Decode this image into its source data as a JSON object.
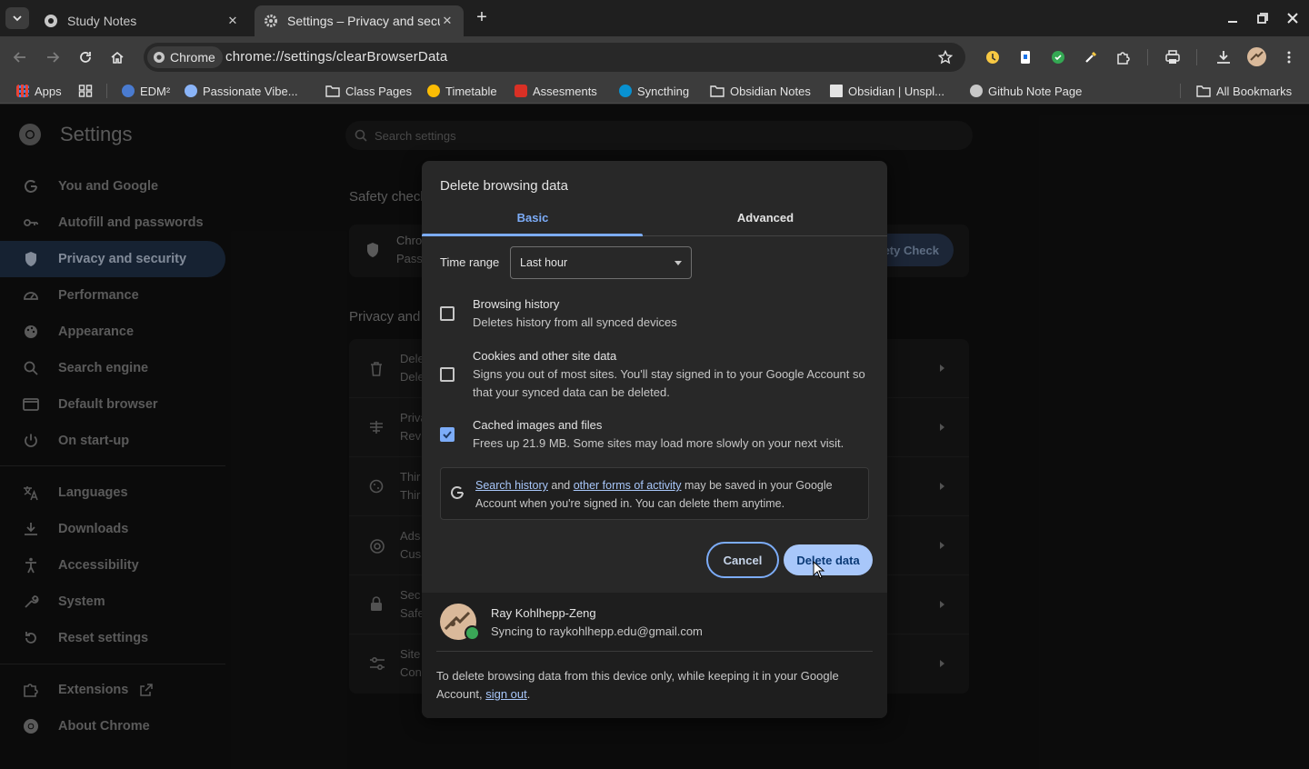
{
  "browser": {
    "tabs": [
      {
        "title": "Study Notes"
      },
      {
        "title": "Settings – Privacy and security"
      }
    ],
    "omnibox": {
      "chip": "Chrome",
      "url": "chrome://settings/clearBrowserData"
    },
    "bookmarks": [
      {
        "label": "Apps",
        "icon": "apps-grid-icon"
      },
      {
        "label": "EDM²",
        "icon": "edm-favicon"
      },
      {
        "label": "Passionate Vibe...",
        "icon": "globe-favicon"
      },
      {
        "label": "Class Pages",
        "icon": "folder-icon"
      },
      {
        "label": "Timetable",
        "icon": "timetable-favicon"
      },
      {
        "label": "Assesments",
        "icon": "assessments-favicon"
      },
      {
        "label": "Syncthing",
        "icon": "syncthing-favicon"
      },
      {
        "label": "Obsidian Notes",
        "icon": "folder-icon"
      },
      {
        "label": "Obsidian | Unspl...",
        "icon": "unsplash-favicon"
      },
      {
        "label": "Github Note Page",
        "icon": "globe-favicon"
      },
      {
        "label": "All Bookmarks",
        "icon": "folder-icon"
      }
    ]
  },
  "settings": {
    "title": "Settings",
    "search_placeholder": "Search settings",
    "nav": [
      {
        "label": "You and Google",
        "icon": "google-icon"
      },
      {
        "label": "Autofill and passwords",
        "icon": "key-icon"
      },
      {
        "label": "Privacy and security",
        "icon": "shield-icon"
      },
      {
        "label": "Performance",
        "icon": "speedometer-icon"
      },
      {
        "label": "Appearance",
        "icon": "palette-icon"
      },
      {
        "label": "Search engine",
        "icon": "search-icon"
      },
      {
        "label": "Default browser",
        "icon": "browser-window-icon"
      },
      {
        "label": "On start-up",
        "icon": "power-icon"
      },
      {
        "label": "Languages",
        "icon": "translate-icon"
      },
      {
        "label": "Downloads",
        "icon": "download-icon"
      },
      {
        "label": "Accessibility",
        "icon": "accessibility-icon"
      },
      {
        "label": "System",
        "icon": "wrench-icon"
      },
      {
        "label": "Reset settings",
        "icon": "reset-icon"
      },
      {
        "label": "Extensions",
        "icon": "puzzle-icon"
      },
      {
        "label": "About Chrome",
        "icon": "chrome-icon"
      }
    ],
    "safety_check_heading": "Safety check",
    "safety_card": {
      "line1": "Chro",
      "line2": "Pass",
      "button": "ety Check"
    },
    "privacy_heading": "Privacy and",
    "privacy_rows": [
      {
        "l1": "Dele",
        "l2": "Dele",
        "icon": "trash-icon"
      },
      {
        "l1": "Priva",
        "l2": "Revi",
        "icon": "privacy-guide-icon"
      },
      {
        "l1": "Thir",
        "l2": "Thir",
        "icon": "cookie-icon"
      },
      {
        "l1": "Ads",
        "l2": "Cus",
        "icon": "ads-icon"
      },
      {
        "l1": "Sec",
        "l2": "Safe",
        "icon": "lock-icon"
      },
      {
        "l1": "Site",
        "l2": "Con",
        "icon": "sliders-icon"
      }
    ]
  },
  "dialog": {
    "title": "Delete browsing data",
    "tabs": {
      "basic": "Basic",
      "advanced": "Advanced"
    },
    "time_range_label": "Time range",
    "time_range_value": "Last hour",
    "options": [
      {
        "title": "Browsing history",
        "desc": "Deletes history from all synced devices",
        "checked": false
      },
      {
        "title": "Cookies and other site data",
        "desc": "Signs you out of most sites. You'll stay signed in to your Google Account so that your synced data can be deleted.",
        "checked": false
      },
      {
        "title": "Cached images and files",
        "desc": "Frees up 21.9 MB. Some sites may load more slowly on your next visit.",
        "checked": true
      }
    ],
    "google_notice": {
      "link1": "Search history",
      "and": " and ",
      "link2": "other forms of activity",
      "rest": " may be saved in your Google Account when you're signed in. You can delete them anytime."
    },
    "cancel_label": "Cancel",
    "delete_label": "Delete data",
    "account": {
      "name": "Ray Kohlhepp-Zeng",
      "email": "Syncing to raykohlhepp.edu@gmail.com"
    },
    "footer": {
      "text": "To delete browsing data from this device only, while keeping it in your Google Account, ",
      "link": "sign out",
      "end": "."
    }
  }
}
